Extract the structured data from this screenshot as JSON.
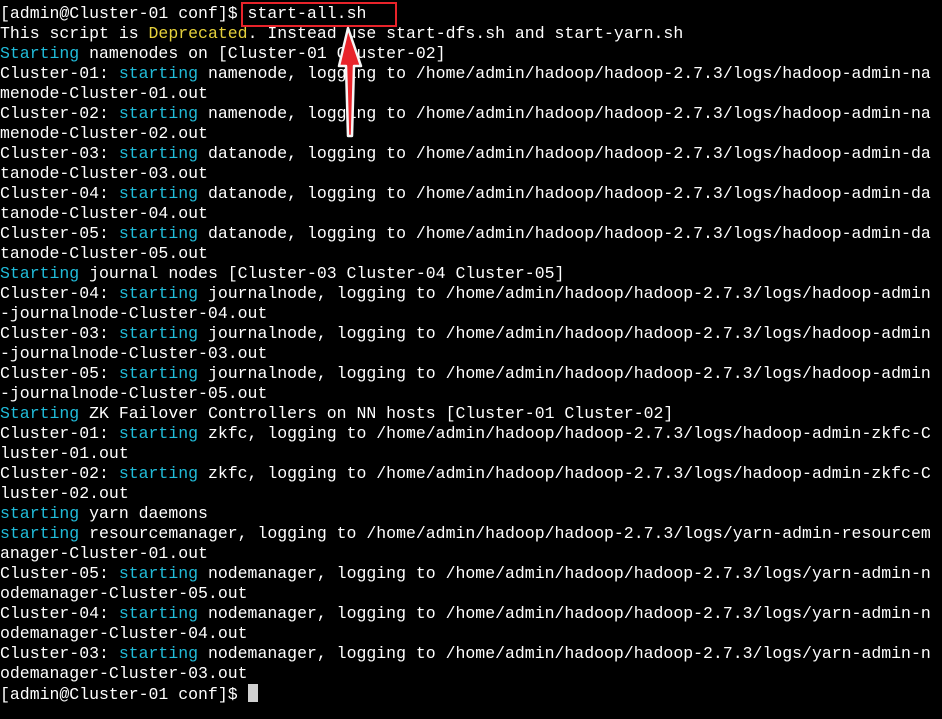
{
  "terminal": {
    "prompt": "[admin@Cluster-01 conf]$ ",
    "command": "start-all.sh",
    "lines": [
      [
        {
          "t": "This script is ",
          "c": "white"
        },
        {
          "t": "Deprecated",
          "c": "yellow"
        },
        {
          "t": ". Instead use start-dfs.sh and start-yarn.sh",
          "c": "white"
        }
      ],
      [
        {
          "t": "Starting",
          "c": "cyan"
        },
        {
          "t": " namenodes on [Cluster-01 Cluster-02]",
          "c": "white"
        }
      ],
      [
        {
          "t": "Cluster-01: ",
          "c": "white"
        },
        {
          "t": "starting",
          "c": "cyan"
        },
        {
          "t": " namenode, logging to /home/admin/hadoop/hadoop-2.7.3/logs/hadoop-admin-na",
          "c": "white"
        }
      ],
      [
        {
          "t": "menode-Cluster-01.out",
          "c": "white"
        }
      ],
      [
        {
          "t": "Cluster-02: ",
          "c": "white"
        },
        {
          "t": "starting",
          "c": "cyan"
        },
        {
          "t": " namenode, logging to /home/admin/hadoop/hadoop-2.7.3/logs/hadoop-admin-na",
          "c": "white"
        }
      ],
      [
        {
          "t": "menode-Cluster-02.out",
          "c": "white"
        }
      ],
      [
        {
          "t": "Cluster-03: ",
          "c": "white"
        },
        {
          "t": "starting",
          "c": "cyan"
        },
        {
          "t": " datanode, logging to /home/admin/hadoop/hadoop-2.7.3/logs/hadoop-admin-da",
          "c": "white"
        }
      ],
      [
        {
          "t": "tanode-Cluster-03.out",
          "c": "white"
        }
      ],
      [
        {
          "t": "Cluster-04: ",
          "c": "white"
        },
        {
          "t": "starting",
          "c": "cyan"
        },
        {
          "t": " datanode, logging to /home/admin/hadoop/hadoop-2.7.3/logs/hadoop-admin-da",
          "c": "white"
        }
      ],
      [
        {
          "t": "tanode-Cluster-04.out",
          "c": "white"
        }
      ],
      [
        {
          "t": "Cluster-05: ",
          "c": "white"
        },
        {
          "t": "starting",
          "c": "cyan"
        },
        {
          "t": " datanode, logging to /home/admin/hadoop/hadoop-2.7.3/logs/hadoop-admin-da",
          "c": "white"
        }
      ],
      [
        {
          "t": "tanode-Cluster-05.out",
          "c": "white"
        }
      ],
      [
        {
          "t": "Starting",
          "c": "cyan"
        },
        {
          "t": " journal nodes [Cluster-03 Cluster-04 Cluster-05]",
          "c": "white"
        }
      ],
      [
        {
          "t": "Cluster-04: ",
          "c": "white"
        },
        {
          "t": "starting",
          "c": "cyan"
        },
        {
          "t": " journalnode, logging to /home/admin/hadoop/hadoop-2.7.3/logs/hadoop-admin",
          "c": "white"
        }
      ],
      [
        {
          "t": "-journalnode-Cluster-04.out",
          "c": "white"
        }
      ],
      [
        {
          "t": "Cluster-03: ",
          "c": "white"
        },
        {
          "t": "starting",
          "c": "cyan"
        },
        {
          "t": " journalnode, logging to /home/admin/hadoop/hadoop-2.7.3/logs/hadoop-admin",
          "c": "white"
        }
      ],
      [
        {
          "t": "-journalnode-Cluster-03.out",
          "c": "white"
        }
      ],
      [
        {
          "t": "Cluster-05: ",
          "c": "white"
        },
        {
          "t": "starting",
          "c": "cyan"
        },
        {
          "t": " journalnode, logging to /home/admin/hadoop/hadoop-2.7.3/logs/hadoop-admin",
          "c": "white"
        }
      ],
      [
        {
          "t": "-journalnode-Cluster-05.out",
          "c": "white"
        }
      ],
      [
        {
          "t": "Starting",
          "c": "cyan"
        },
        {
          "t": " ZK Failover Controllers on NN hosts [Cluster-01 Cluster-02]",
          "c": "white"
        }
      ],
      [
        {
          "t": "Cluster-01: ",
          "c": "white"
        },
        {
          "t": "starting",
          "c": "cyan"
        },
        {
          "t": " zkfc, logging to /home/admin/hadoop/hadoop-2.7.3/logs/hadoop-admin-zkfc-C",
          "c": "white"
        }
      ],
      [
        {
          "t": "luster-01.out",
          "c": "white"
        }
      ],
      [
        {
          "t": "Cluster-02: ",
          "c": "white"
        },
        {
          "t": "starting",
          "c": "cyan"
        },
        {
          "t": " zkfc, logging to /home/admin/hadoop/hadoop-2.7.3/logs/hadoop-admin-zkfc-C",
          "c": "white"
        }
      ],
      [
        {
          "t": "luster-02.out",
          "c": "white"
        }
      ],
      [
        {
          "t": "starting",
          "c": "cyan"
        },
        {
          "t": " yarn daemons",
          "c": "white"
        }
      ],
      [
        {
          "t": "starting",
          "c": "cyan"
        },
        {
          "t": " resourcemanager, logging to /home/admin/hadoop/hadoop-2.7.3/logs/yarn-admin-resourcem",
          "c": "white"
        }
      ],
      [
        {
          "t": "anager-Cluster-01.out",
          "c": "white"
        }
      ],
      [
        {
          "t": "Cluster-05: ",
          "c": "white"
        },
        {
          "t": "starting",
          "c": "cyan"
        },
        {
          "t": " nodemanager, logging to /home/admin/hadoop/hadoop-2.7.3/logs/yarn-admin-n",
          "c": "white"
        }
      ],
      [
        {
          "t": "odemanager-Cluster-05.out",
          "c": "white"
        }
      ],
      [
        {
          "t": "Cluster-04: ",
          "c": "white"
        },
        {
          "t": "starting",
          "c": "cyan"
        },
        {
          "t": " nodemanager, logging to /home/admin/hadoop/hadoop-2.7.3/logs/yarn-admin-n",
          "c": "white"
        }
      ],
      [
        {
          "t": "odemanager-Cluster-04.out",
          "c": "white"
        }
      ],
      [
        {
          "t": "Cluster-03: ",
          "c": "white"
        },
        {
          "t": "starting",
          "c": "cyan"
        },
        {
          "t": " nodemanager, logging to /home/admin/hadoop/hadoop-2.7.3/logs/yarn-admin-n",
          "c": "white"
        }
      ],
      [
        {
          "t": "odemanager-Cluster-03.out",
          "c": "white"
        }
      ]
    ],
    "final_prompt": "[admin@Cluster-01 conf]$ "
  },
  "colors": {
    "background": "#000000",
    "text": "#ffffff",
    "keyword": "#21bcd9",
    "warning": "#e5d13c",
    "annotation": "#e8232a"
  },
  "icons": {
    "annotation_arrow": "up-arrow-icon",
    "cursor": "block-cursor"
  }
}
